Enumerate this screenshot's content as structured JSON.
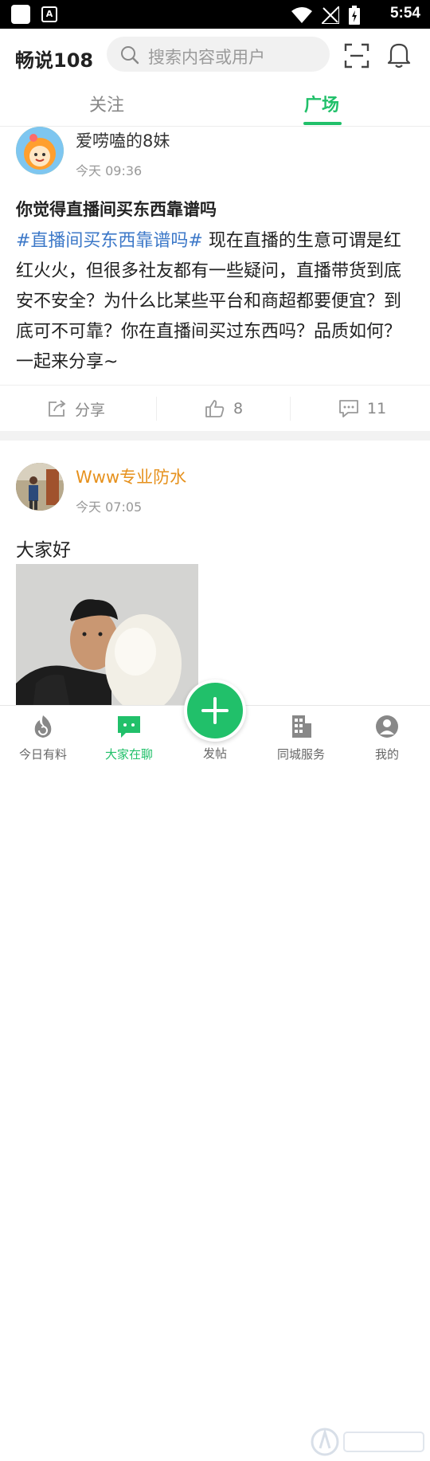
{
  "status_bar": {
    "time": "5:54",
    "app_icon_letter": "A"
  },
  "header": {
    "title": "畅说108",
    "search_placeholder": "搜索内容或用户",
    "icons": [
      "search-icon",
      "scan-icon",
      "bell-icon"
    ]
  },
  "tabs": [
    {
      "label": "关注",
      "active": false
    },
    {
      "label": "广场",
      "active": true
    }
  ],
  "posts": [
    {
      "username": "爱唠嗑的8妹",
      "time": "今天 09:36",
      "title": "你觉得直播间买东西靠谱吗",
      "hashtag": "#直播间买东西靠谱吗#",
      "body": " 现在直播的生意可谓是红红火火，但很多社友都有一些疑问，直播带货到底安不安全？为什么比某些平台和商超都要便宜？到底可不可靠？你在直播间买过东西吗？品质如何？一起来分享~",
      "actions": {
        "share_label": "分享",
        "like_count": "8",
        "comment_count": "11"
      }
    },
    {
      "username": "Www专业防水",
      "time": "今天 07:05",
      "text": "大家好"
    }
  ],
  "bottom_nav": [
    {
      "label": "今日有料",
      "icon": "flame-refresh-icon",
      "active": false
    },
    {
      "label": "大家在聊",
      "icon": "chat-bubble-icon",
      "active": true
    },
    {
      "label": "发帖",
      "icon": "plus-icon",
      "active": false
    },
    {
      "label": "同城服务",
      "icon": "building-icon",
      "active": false
    },
    {
      "label": "我的",
      "icon": "profile-icon",
      "active": false
    }
  ],
  "colors": {
    "accent": "#21c06a",
    "hashtag": "#3c78c8",
    "username_highlight": "#e6911d"
  }
}
